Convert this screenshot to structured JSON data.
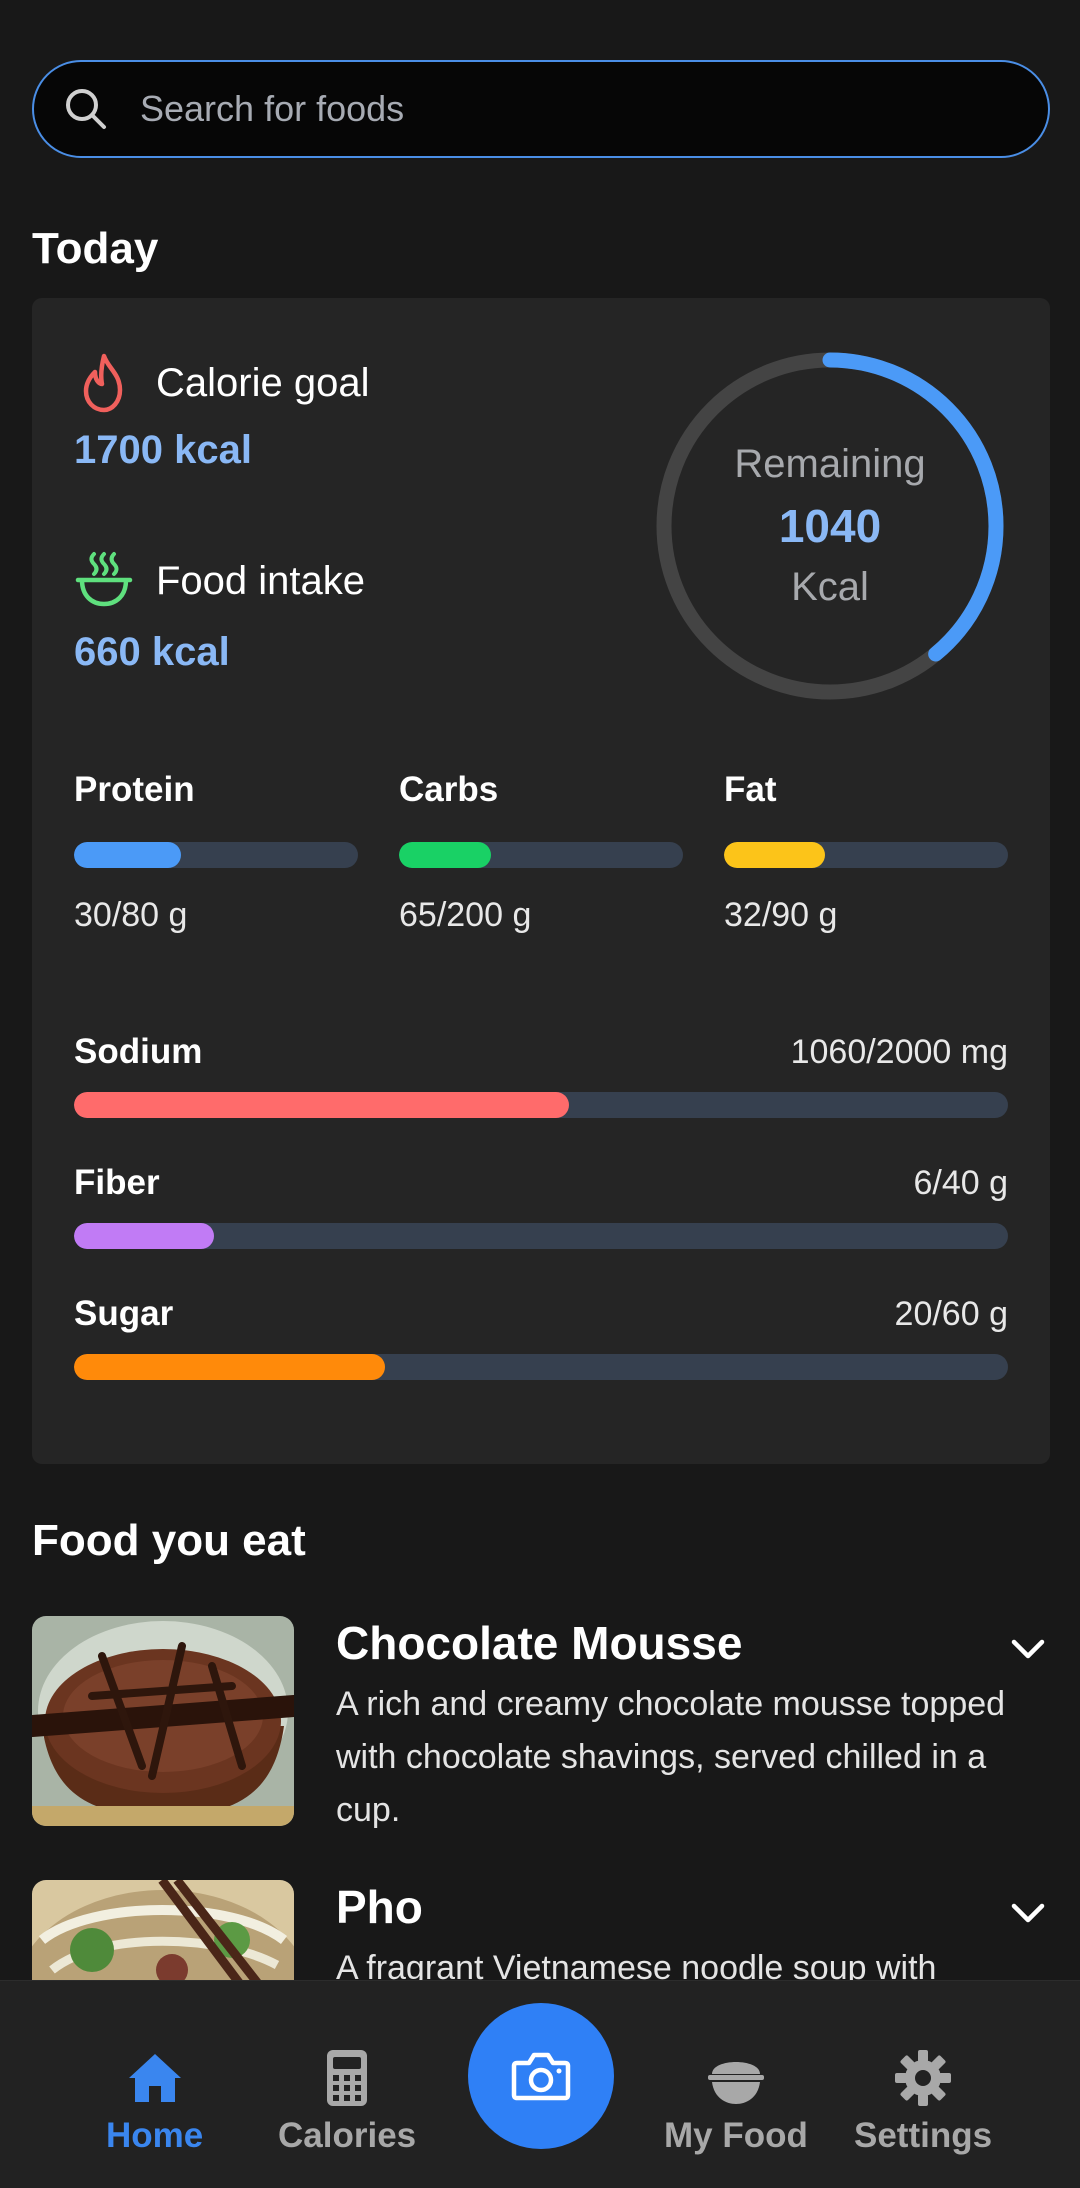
{
  "search": {
    "placeholder": "Search for foods",
    "icon": "search-icon"
  },
  "today": {
    "title": "Today",
    "calorie_goal": {
      "label": "Calorie goal",
      "value": "1700 kcal",
      "icon": "flame-icon",
      "icon_color": "#f0605c"
    },
    "food_intake": {
      "label": "Food intake",
      "value": "660 kcal",
      "icon": "bowl-steam-icon",
      "icon_color": "#5fe07e"
    },
    "ring": {
      "label": "Remaining",
      "value": "1040",
      "unit": "Kcal",
      "progress_fraction": 0.39,
      "color": "#4b9af7",
      "track_color": "#444444"
    },
    "macros": [
      {
        "name": "Protein",
        "value": "30/80 g",
        "fraction": 0.375,
        "color": "#4b9af7"
      },
      {
        "name": "Carbs",
        "value": "65/200 g",
        "fraction": 0.325,
        "color": "#19d165"
      },
      {
        "name": "Fat",
        "value": "32/90 g",
        "fraction": 0.356,
        "color": "#fcc419"
      }
    ],
    "nutrients": [
      {
        "name": "Sodium",
        "value": "1060/2000 mg",
        "fraction": 0.53,
        "color": "#ff6b6b"
      },
      {
        "name": "Fiber",
        "value": "6/40 g",
        "fraction": 0.15,
        "color": "#c17bf5"
      },
      {
        "name": "Sugar",
        "value": "20/60 g",
        "fraction": 0.333,
        "color": "#ff8a0a"
      }
    ]
  },
  "foods": {
    "title": "Food you eat",
    "items": [
      {
        "name": "Chocolate Mousse",
        "description": "A rich and creamy chocolate mousse topped with chocolate shavings, served chilled in a cup."
      },
      {
        "name": "Pho",
        "description": "A fragrant Vietnamese noodle soup with"
      }
    ]
  },
  "nav": {
    "items": [
      {
        "label": "Home",
        "icon": "home-icon",
        "active": true
      },
      {
        "label": "Calories",
        "icon": "calculator-icon",
        "active": false
      },
      {
        "label": "My Food",
        "icon": "rice-bowl-icon",
        "active": false
      },
      {
        "label": "Settings",
        "icon": "gear-icon",
        "active": false
      }
    ],
    "camera_icon": "camera-icon"
  },
  "colors": {
    "accent": "#2f80f6",
    "background": "#181818",
    "card": "#252525",
    "value_text": "#8ab8f5"
  }
}
